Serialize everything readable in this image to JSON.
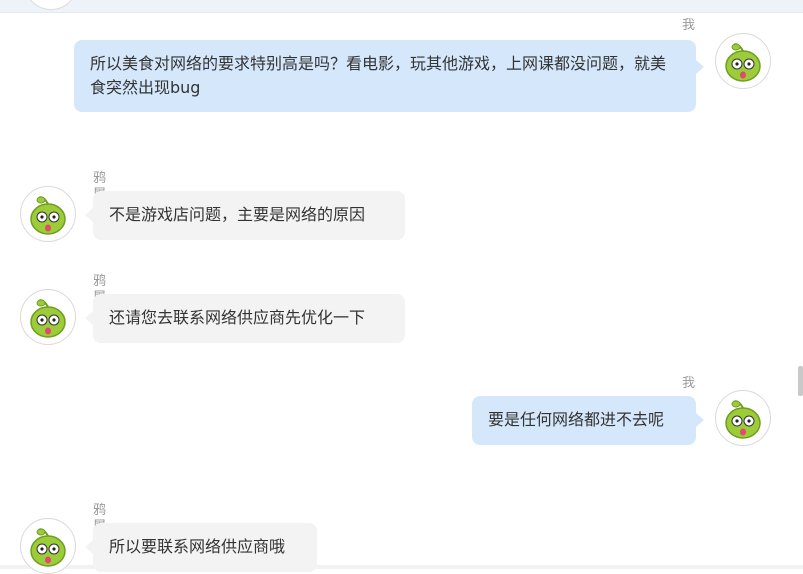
{
  "conversation": {
    "messages": [
      {
        "sender": "我",
        "side": "me",
        "text": "所以美食对网络的要求特别高是吗？看电影，玩其他游戏，上网课都没问题，就美食突然出现bug"
      },
      {
        "sender": "鸦屠",
        "side": "them",
        "text": "不是游戏店问题，主要是网络的原因"
      },
      {
        "sender": "鸦屠",
        "side": "them",
        "text": "还请您去联系网络供应商先优化一下"
      },
      {
        "sender": "我",
        "side": "me",
        "text": "要是任何网络都进不去呢"
      },
      {
        "sender": "鸦屠",
        "side": "them",
        "text": "所以要联系网络供应商哦"
      }
    ]
  },
  "avatar": {
    "icon": "green-cartoon-sprout-avatar",
    "color": "#9ccc3a"
  },
  "colors": {
    "my_bubble": "#d5e8fb",
    "their_bubble": "#f3f3f3",
    "sender_label": "#9a9a9a"
  }
}
